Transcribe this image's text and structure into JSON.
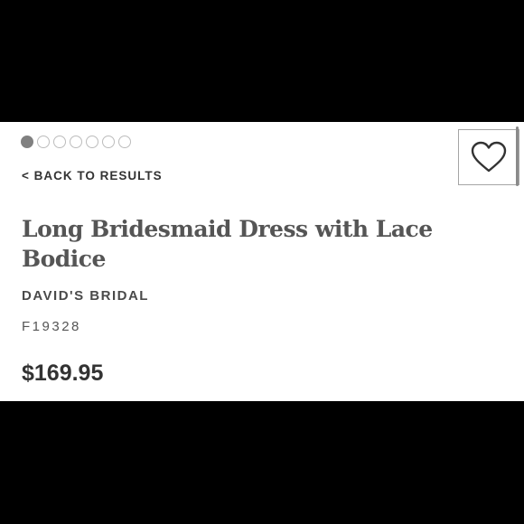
{
  "gallery": {
    "slide_count": 7,
    "active_index": 0,
    "colors": {
      "active": "#808080",
      "inactive_border": "#bcbcbc"
    }
  },
  "nav": {
    "back_label": "< BACK TO RESULTS"
  },
  "product": {
    "title": "Long Bridesmaid Dress with Lace Bodice",
    "brand": "DAVID'S BRIDAL",
    "sku": "F19328",
    "price": "$169.95"
  },
  "favorite": {
    "icon": "heart-outline-icon"
  }
}
